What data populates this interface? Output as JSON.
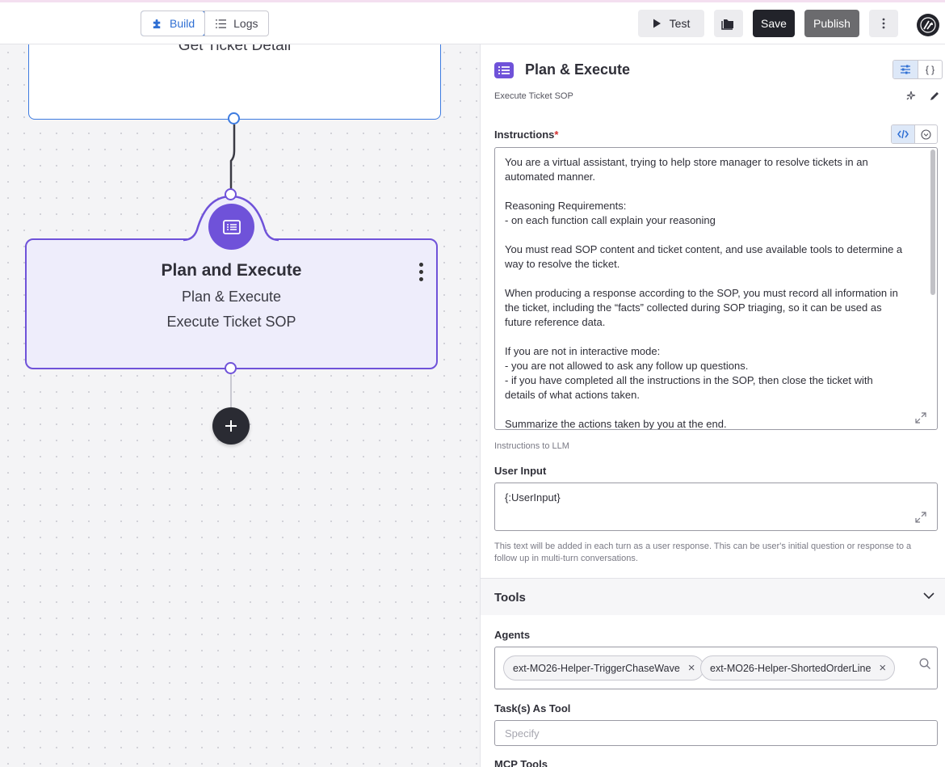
{
  "toolbar": {
    "build_label": "Build",
    "logs_label": "Logs",
    "test_label": "Test",
    "save_label": "Save",
    "publish_label": "Publish"
  },
  "canvas": {
    "top_node_title": "Get Ticket Detail",
    "main_node": {
      "title": "Plan and Execute",
      "subtitle": "Plan & Execute",
      "description": "Execute Ticket SOP"
    }
  },
  "panel": {
    "title": "Plan & Execute",
    "subtitle": "Execute Ticket SOP",
    "instructions": {
      "label": "Instructions",
      "required_mark": "*",
      "value": "You are a virtual assistant, trying to help store manager to resolve tickets in an automated manner.\n\nReasoning Requirements:\n- on each function call explain your reasoning\n\nYou must read SOP content and ticket content, and use available tools to determine a way to resolve the ticket.\n\nWhen producing a response according to the SOP, you must record all information in the ticket, including the “facts” collected during SOP triaging, so it can be used as future reference data.\n\nIf you are not in interactive mode:\n- you are not allowed to ask any follow up questions.\n- if you have completed all the instructions in the SOP, then close the ticket with details of what actions taken.\n\nSummarize the actions taken by you at the end.",
      "help": "Instructions to LLM"
    },
    "user_input": {
      "label": "User Input",
      "value": "{:UserInput}",
      "help": "This text will be added in each turn as a user response. This can be user's initial question or response to a follow up in multi-turn conversations."
    },
    "tools": {
      "section_title": "Tools",
      "agents_label": "Agents",
      "agents": [
        "ext-MO26-Helper-TriggerChaseWave",
        "ext-MO26-Helper-ShortedOrderLine"
      ],
      "tasks_label": "Task(s) As Tool",
      "tasks_placeholder": "Specify",
      "mcp_label": "MCP Tools"
    }
  },
  "colors": {
    "accent_purple": "#6f52d9",
    "accent_blue": "#2f6fd3",
    "save_bg": "#22232a",
    "publish_bg": "#6b6b6e"
  }
}
